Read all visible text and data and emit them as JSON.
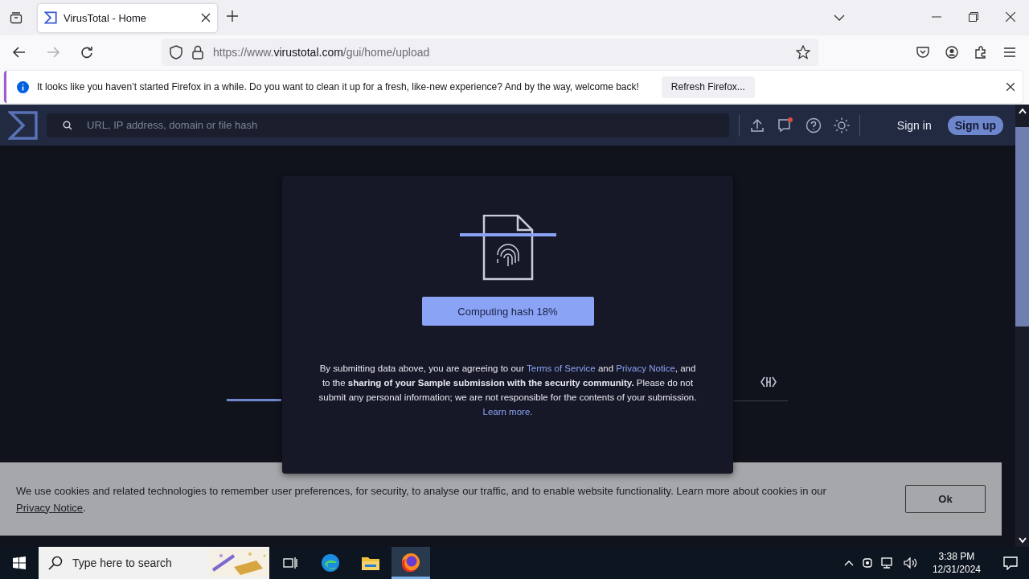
{
  "tabs": [
    {
      "title": "VirusTotal - Home",
      "selected": true
    }
  ],
  "nav_buttons": [
    {
      "kind": "back",
      "disabled": false
    },
    {
      "kind": "forward",
      "disabled": true
    },
    {
      "kind": "reload",
      "disabled": false
    }
  ],
  "address": {
    "prefix": "https://www.",
    "domain": "virustotal.com",
    "path": "/gui/home/upload"
  },
  "notification": {
    "message": "It looks like you haven’t started Firefox in a while. Do you want to clean it up for a fresh, like-new experience? And by the way, welcome back!",
    "button": "Refresh Firefox..."
  },
  "site_header": {
    "search_placeholder": "URL, IP address, domain or file hash",
    "unread_messages": true,
    "sign_in": "Sign in",
    "sign_up": "Sign up"
  },
  "modal": {
    "button": "Computing hash 18%",
    "notice": [
      {
        "kind": "text",
        "text": "By submitting data above, you are agreeing to our "
      },
      {
        "kind": "link",
        "text": "Terms of Service"
      },
      {
        "kind": "text",
        "text": " and "
      },
      {
        "kind": "link",
        "text": "Privacy Notice"
      },
      {
        "kind": "text",
        "text": ", and to the **sharing of your Sample submission with the security community.** Please do not submit any personal information; we are not responsible for the contents of your submission. "
      },
      {
        "kind": "link",
        "text": "Learn more."
      }
    ]
  },
  "cookie_bar": {
    "text": "We use cookies and related technologies to remember user preferences, for security, to analyse our traffic, and to enable website functionality. Learn more about cookies in our ",
    "link": "Privacy Notice",
    "after": ".",
    "button": "Ok"
  },
  "taskbar": {
    "search_placeholder": "Type here to search",
    "apps": [
      {
        "kind": "task_view",
        "selected": false
      },
      {
        "kind": "edge",
        "selected": false
      },
      {
        "kind": "explorer",
        "selected": false
      },
      {
        "kind": "firefox",
        "selected": true
      }
    ],
    "time": "3:38 PM",
    "date": "12/31/2024"
  }
}
